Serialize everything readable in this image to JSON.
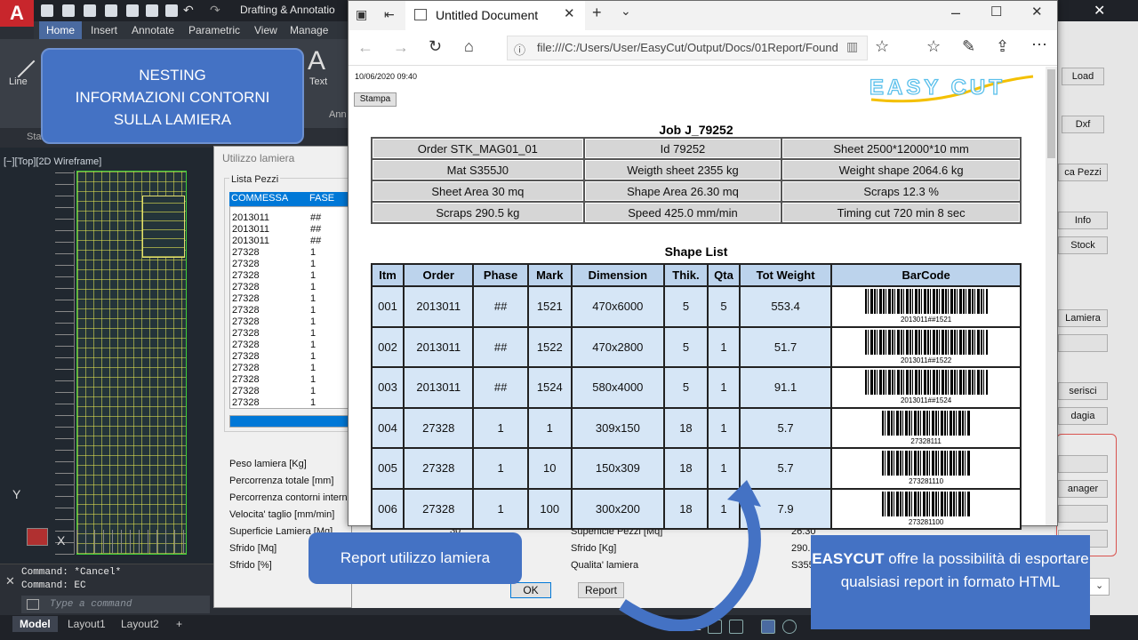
{
  "cad": {
    "logo": "A",
    "workspace": "Drafting & Annotatio",
    "tabs": [
      "Home",
      "Insert",
      "Annotate",
      "Parametric",
      "View",
      "Manage"
    ],
    "tools": {
      "line": "Line",
      "text": "Text",
      "text_icon": "A",
      "annotation_panel": "Ann"
    },
    "file_tab": "Star",
    "view_label": "[−][Top][2D Wireframe]",
    "axis_y": "Y",
    "axis_x": "X",
    "command_lines": [
      "Command: *Cancel*",
      "Command: EC"
    ],
    "command_placeholder": "Type a command",
    "layout_tabs": [
      "Model",
      "Layout1",
      "Layout2",
      "+"
    ],
    "model_status": "MODEL"
  },
  "right_panel": {
    "buttons": [
      "Load",
      "Dxf",
      "ca Pezzi",
      "Info",
      "Stock",
      "Lamiera",
      "",
      "serisci",
      "dagia",
      "",
      "anager",
      "",
      ""
    ]
  },
  "dialog": {
    "title": "Utilizzo lamiera",
    "list_group": "Lista Pezzi",
    "headers": [
      "COMMESSA",
      "FASE"
    ],
    "rows": [
      [
        "2013011",
        "##"
      ],
      [
        "2013011",
        "##"
      ],
      [
        "2013011",
        "##"
      ],
      [
        "27328",
        "1"
      ],
      [
        "27328",
        "1"
      ],
      [
        "27328",
        "1"
      ],
      [
        "27328",
        "1"
      ],
      [
        "27328",
        "1"
      ],
      [
        "27328",
        "1"
      ],
      [
        "27328",
        "1"
      ],
      [
        "27328",
        "1"
      ],
      [
        "27328",
        "1"
      ],
      [
        "27328",
        "1"
      ],
      [
        "27328",
        "1"
      ],
      [
        "27328",
        "1"
      ],
      [
        "27328",
        "1"
      ],
      [
        "27328",
        "1"
      ]
    ],
    "stats_left": [
      "Peso lamiera [Kg]",
      "Percorrenza totale [mm]",
      "Percorrenza contorni interni",
      "Velocita' taglio [mm/min]",
      "Superficie Lamiera [Mq]",
      "Sfrido [Mq]",
      "Sfrido [%]"
    ],
    "stats_left_value": "30",
    "stats_right": [
      "Superficie Pezzi [Mq]",
      "Sfrido [Kg]",
      "Qualita' lamiera"
    ],
    "stats_right_values": [
      "26.30",
      "290.",
      "S355"
    ],
    "ok": "OK",
    "report": "Report"
  },
  "browser": {
    "tab_title": "Untitled Document",
    "url": "file:///C:/Users/User/EasyCut/Output/Docs/01Report/Found"
  },
  "report": {
    "date": "10/06/2020 09:40",
    "print": "Stampa",
    "logo": "EASY CUT",
    "job": "Job  J_79252",
    "info": [
      [
        "Order STK_MAG01_01",
        "Id 79252",
        "Sheet 2500*12000*10 mm"
      ],
      [
        "Mat S355J0",
        "Weigth sheet 2355 kg",
        "Weight shape 2064.6 kg"
      ],
      [
        "Sheet Area 30 mq",
        "Shape Area 26.30 mq",
        "Scraps 12.3 %"
      ],
      [
        "Scraps 290.5 kg",
        "Speed 425.0 mm/min",
        "Timing cut 720 min 8 sec"
      ]
    ],
    "shape_list_title": "Shape   List",
    "columns": [
      "Itm",
      "Order",
      "Phase",
      "Mark",
      "Dimension",
      "Thik.",
      "Qta",
      "Tot Weight",
      "BarCode"
    ],
    "shapes": [
      [
        "001",
        "2013011",
        "##",
        "1521",
        "470x6000",
        "5",
        "5",
        "553.4",
        "2013011##1521"
      ],
      [
        "002",
        "2013011",
        "##",
        "1522",
        "470x2800",
        "5",
        "1",
        "51.7",
        "2013011##1522"
      ],
      [
        "003",
        "2013011",
        "##",
        "1524",
        "580x4000",
        "5",
        "1",
        "91.1",
        "2013011##1524"
      ],
      [
        "004",
        "27328",
        "1",
        "1",
        "309x150",
        "18",
        "1",
        "5.7",
        "27328111"
      ],
      [
        "005",
        "27328",
        "1",
        "10",
        "150x309",
        "18",
        "1",
        "5.7",
        "273281110"
      ],
      [
        "006",
        "27328",
        "1",
        "100",
        "300x200",
        "18",
        "1",
        "7.9",
        "273281100"
      ]
    ]
  },
  "callouts": {
    "nesting": [
      "NESTING",
      "INFORMAZIONI CONTORNI",
      "SULLA LAMIERA"
    ],
    "report": "Report utilizzo lamiera",
    "easycut_bold": "EASYCUT",
    "easycut_rest": " offre la possibilità di esportare qualsiasi report in formato HTML"
  },
  "colors": {
    "accent": "#4472c4",
    "cad_red": "#c8262c",
    "table_header": "#bcd3ec",
    "table_cell": "#d6e6f6"
  }
}
